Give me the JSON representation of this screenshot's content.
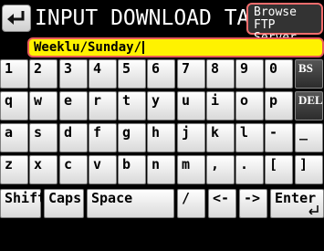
{
  "header": {
    "title": "INPUT DOWNLOAD TARGET",
    "back_icon": "return-arrow-icon",
    "browse_line1": "Browse",
    "browse_line2": "FTP Server"
  },
  "input": {
    "value": "Weeklu/Sunday/"
  },
  "keyboard": {
    "row1": [
      "1",
      "2",
      "3",
      "4",
      "5",
      "6",
      "7",
      "8",
      "9",
      "0",
      "BS"
    ],
    "row2": [
      "q",
      "w",
      "e",
      "r",
      "t",
      "y",
      "u",
      "i",
      "o",
      "p",
      "DEL"
    ],
    "row3": [
      "a",
      "s",
      "d",
      "f",
      "g",
      "h",
      "j",
      "k",
      "l",
      "-",
      "_"
    ],
    "row4": [
      "z",
      "x",
      "c",
      "v",
      "b",
      "n",
      "m",
      ",",
      ".",
      "[",
      "]"
    ],
    "row5": {
      "shift": "Shift",
      "caps": "Caps",
      "space": "Space",
      "slash": "/",
      "left": "<-",
      "right": "->",
      "enter": "Enter"
    }
  },
  "colors": {
    "background": "#000000",
    "input_bg": "#fff200",
    "highlight_border": "#f26c6c"
  }
}
